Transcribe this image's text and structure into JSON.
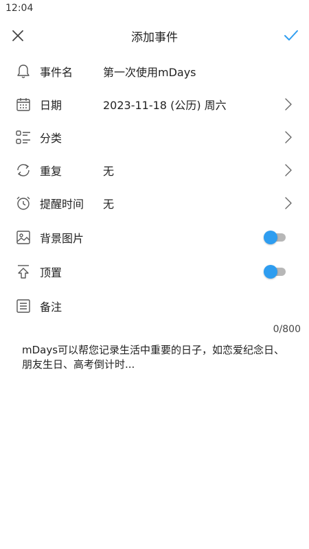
{
  "status_bar": {
    "time": "12:04"
  },
  "app_bar": {
    "title": "添加事件",
    "close_icon": "close-icon",
    "confirm_icon": "check-icon",
    "accent_color": "#2e9df0"
  },
  "rows": {
    "event_name": {
      "label": "事件名",
      "value": "第一次使用mDays",
      "icon": "bell-icon"
    },
    "date": {
      "label": "日期",
      "value": "2023-11-18 (公历) 周六",
      "icon": "calendar-icon"
    },
    "category": {
      "label": "分类",
      "value": "",
      "icon": "list-icon"
    },
    "repeat": {
      "label": "重复",
      "value": "无",
      "icon": "repeat-icon"
    },
    "reminder": {
      "label": "提醒时间",
      "value": "无",
      "icon": "alarm-icon"
    },
    "background": {
      "label": "背景图片",
      "icon": "image-icon",
      "toggle_color": "#2e9df0"
    },
    "pin": {
      "label": "顶置",
      "icon": "pin-top-icon",
      "toggle_color": "#2e9df0"
    },
    "notes": {
      "label": "备注",
      "icon": "note-icon"
    }
  },
  "notes": {
    "counter": "0/800",
    "placeholder": "mDays可以帮您记录生活中重要的日子，如恋爱纪念日、朋友生日、高考倒计时..."
  }
}
